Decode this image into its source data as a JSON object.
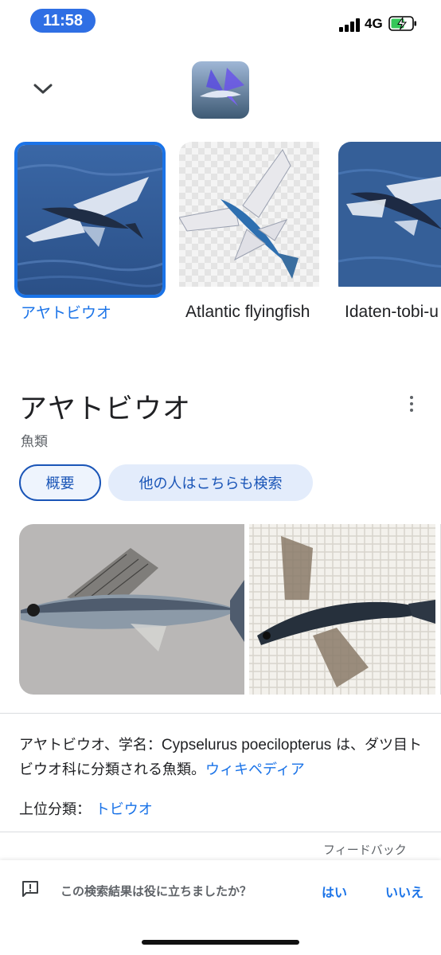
{
  "status_bar": {
    "time": "11:58",
    "network": "4G"
  },
  "carousel": {
    "items": [
      {
        "label": "アヤトビウオ",
        "selected": true
      },
      {
        "label": "Atlantic flyingfish",
        "selected": false
      },
      {
        "label": "Idaten-tobi-u",
        "selected": false
      }
    ]
  },
  "entity": {
    "title": "アヤトビウオ",
    "subtitle": "魚類"
  },
  "chips": [
    {
      "label": "概要",
      "active": true
    },
    {
      "label": "他の人はこちらも検索",
      "active": false
    }
  ],
  "description": {
    "prefix": "アヤトビウオ、学名：",
    "scientific_name": "Cypselurus poecilopterus",
    "suffix": " は、ダツ目トビウオ科に分類される魚類。",
    "source_link": "ウィキペディア"
  },
  "parent_taxon": {
    "label": "上位分類：",
    "value": "トビウオ"
  },
  "feedback": {
    "link": "フィードバック",
    "question": "この検索結果は役に立ちましたか？",
    "yes": "はい",
    "no": "いいえ"
  },
  "colors": {
    "accent": "#1a73e8",
    "time_pill": "#2f6fe4",
    "battery_charge": "#34c759"
  }
}
